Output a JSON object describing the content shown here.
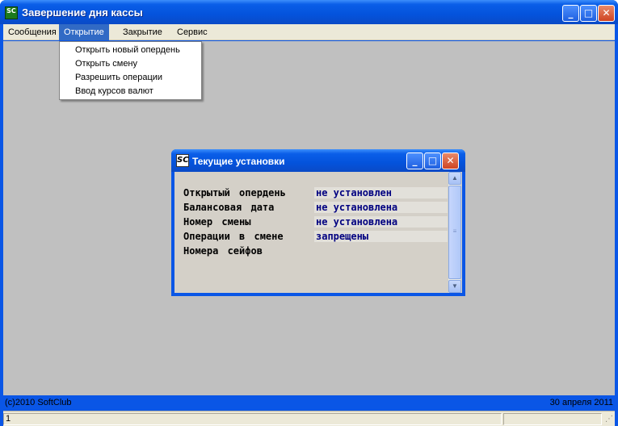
{
  "window": {
    "title": "Завершение дня кассы",
    "app_icon_text": "SC",
    "controls": {
      "minimize": "_",
      "maximize": "□",
      "close": "✕"
    }
  },
  "menubar": {
    "items": [
      {
        "label": "Сообщения",
        "active": false
      },
      {
        "label": "Открытие",
        "active": true
      },
      {
        "label": "Закрытие",
        "active": false
      },
      {
        "label": "Сервис",
        "active": false
      }
    ]
  },
  "dropdown": {
    "items": [
      {
        "label": "Открыть новый опердень"
      },
      {
        "label": "Открыть смену"
      },
      {
        "label": "Разрешить операции"
      },
      {
        "label": "Ввод курсов валют"
      }
    ]
  },
  "dialog": {
    "title": "Текущие установки",
    "icon_text": "SC",
    "rows": [
      {
        "label": "Открытый опердень",
        "value": "не установлен"
      },
      {
        "label": "Балансовая дата",
        "value": "не установлена"
      },
      {
        "label": "Номер смены",
        "value": "не установлена"
      },
      {
        "label": "Операции в смене",
        "value": "запрещены"
      },
      {
        "label": "Номера сейфов",
        "value": ""
      }
    ]
  },
  "footer": {
    "copyright": "(c)2010 SoftClub",
    "date": "30 апреля 2011"
  },
  "statusbar": {
    "cell1": "1"
  },
  "colors": {
    "titlebar": "#0a56e6",
    "menu_active": "#316ac5",
    "client_bg": "#c0c0c0",
    "dialog_value_text": "#000080"
  }
}
